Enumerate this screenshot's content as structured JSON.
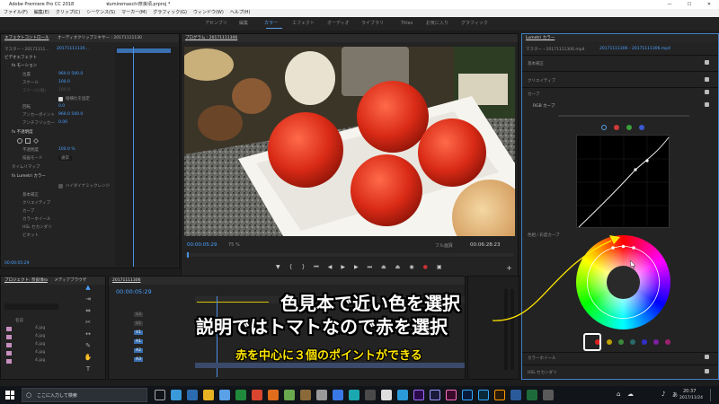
{
  "app": {
    "title": "Adobe Premiere Pro CC 2018",
    "file": "ฟumiremaschi奈良頃.prproj *",
    "window_controls": [
      "—",
      "☐",
      "✕"
    ]
  },
  "menu": [
    "ファイル(F)",
    "編集(E)",
    "クリップ(C)",
    "シーケンス(S)",
    "マーカー(M)",
    "グラフィック(G)",
    "ウィンドウ(W)",
    "ヘルプ(H)"
  ],
  "workspaces": [
    "アセンブリ",
    "編集",
    "カラー",
    "エフェクト",
    "オーディオ",
    "ライブラリ",
    "Titles",
    "お気に入り",
    "グラフィック"
  ],
  "workspace_active": "カラー",
  "effect_controls": {
    "tabs": [
      "エフェクトコントロール",
      "オーディオクリップミキサー : 20171111130"
    ],
    "source": "マスター・20171111...",
    "clip": "20171111130...",
    "section": "ビデオエフェクト",
    "rows": [
      {
        "label": "fx モーション",
        "value": ""
      },
      {
        "label": "位置",
        "value": "960.0   540.0"
      },
      {
        "label": "スケール",
        "value": "100.0"
      },
      {
        "label": "スケール(幅)",
        "value": "100.0"
      },
      {
        "label": "縦横比を固定",
        "value": ""
      },
      {
        "label": "回転",
        "value": "0.0"
      },
      {
        "label": "アンカーポイント",
        "value": "960.0   540.0"
      },
      {
        "label": "アンチフリッカー",
        "value": "0.00"
      },
      {
        "label": "fx 不透明度",
        "value": ""
      },
      {
        "label": "不透明度",
        "value": "100.0 %"
      },
      {
        "label": "描画モード",
        "value": "通常"
      },
      {
        "label": "タイムリマップ",
        "value": ""
      },
      {
        "label": "fx Lumetri カラー",
        "value": ""
      },
      {
        "label": "ハイダイナミックレンジ",
        "value": ""
      },
      {
        "label": "基本補正",
        "value": ""
      },
      {
        "label": "クリエイティブ",
        "value": ""
      },
      {
        "label": "カーブ",
        "value": ""
      },
      {
        "label": "カラーホイール",
        "value": ""
      },
      {
        "label": "HSL セカンダリ",
        "value": ""
      },
      {
        "label": "ビネット",
        "value": ""
      }
    ],
    "timecode_bottom": "00:00:05:29"
  },
  "program": {
    "tab": "プログラム : 20171111306",
    "timecode": "00:00:05:29",
    "zoom": "75 %",
    "quality": "フル画質",
    "duration": "00:06:28:23"
  },
  "lumetri": {
    "tab": "Lumetri カラー",
    "master_label": "マスター・20171111306.mp4",
    "clip_label": "20171111306 - 20171111306.mp4",
    "sections": [
      "基本補正",
      "クリエイティブ",
      "カーブ",
      "RGB カーブ"
    ],
    "hsl_label": "色相 / 彩度カーブ",
    "bottom_sections": [
      "カラーホイール",
      "HSL セカンダリ"
    ],
    "curve_channel_colors": [
      "#ffffff",
      "#d03a3a",
      "#3aa03a",
      "#3a5ad0"
    ],
    "swatch_colors": [
      "#e02020",
      "#c0a000",
      "#3a8a3a",
      "#2a6a6a",
      "#3030c8",
      "#7a20a0",
      "#a02070"
    ],
    "selected_swatch": "#e02020"
  },
  "project": {
    "tabs": [
      "プロジェクト: 奈良頃ro",
      "メディアブラウザ"
    ],
    "column": "名前",
    "items": [
      "4.jpg",
      "4.jpg",
      "4.jpg",
      "4.jpg",
      "4.jpg"
    ]
  },
  "timeline": {
    "tab": "20171111306",
    "timecode": "00:00:05:29",
    "tracks": [
      "V3",
      "V2",
      "V1",
      "A1",
      "A2",
      "A3"
    ]
  },
  "annotations": {
    "line1": "色見本で近い色を選択",
    "line2": "説明ではトマトなので赤を選択",
    "line3": "赤を中心に３個のポイントができる"
  },
  "taskbar": {
    "search": "ここに入力して検索",
    "time": "20:37",
    "date": "2017/11/24"
  }
}
